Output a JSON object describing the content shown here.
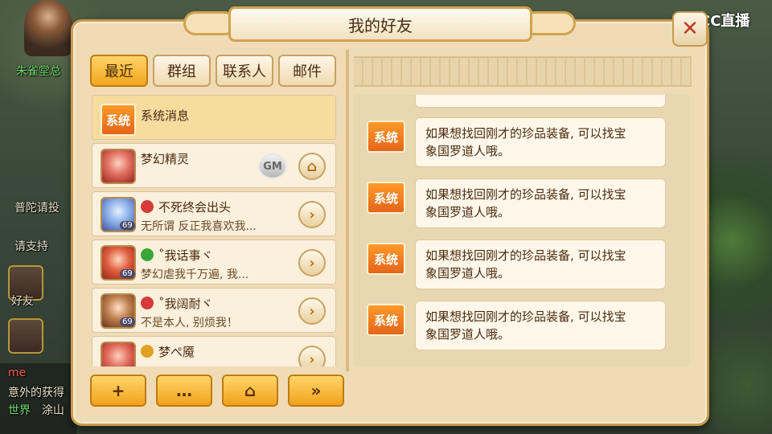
{
  "window": {
    "title": "我的好友",
    "close_icon": "close-x-icon"
  },
  "overlay": {
    "watermark": "CC直播"
  },
  "background_hud": {
    "left_labels": [
      {
        "text": "朱雀堂总",
        "color": "green"
      },
      {
        "text": "普陀请投",
        "color": "normal"
      },
      {
        "text": "请支持",
        "color": "normal"
      },
      {
        "text": "好友",
        "color": "normal"
      },
      {
        "text": "me",
        "color": "normal"
      },
      {
        "text": "意外的获得",
        "color": "normal"
      },
      {
        "text": "世界",
        "color": "green"
      },
      {
        "text": "涂山",
        "color": "normal"
      }
    ]
  },
  "tabs": [
    {
      "label": "最近",
      "active": true
    },
    {
      "label": "群组",
      "active": false
    },
    {
      "label": "联系人",
      "active": false
    },
    {
      "label": "邮件",
      "active": false
    }
  ],
  "friends": [
    {
      "type": "system",
      "name": "系统消息",
      "icon_label": "系统"
    },
    {
      "type": "gm",
      "name": "梦幻精灵",
      "badge": "GM",
      "action_icon": "home-icon"
    },
    {
      "type": "player",
      "name": "不死终会出头",
      "message": "无所谓 反正我喜欢我...",
      "level": "69",
      "status_color": "#d63a3a",
      "action_icon": "chevron-right-icon"
    },
    {
      "type": "player",
      "name": "˚我话事ヾ",
      "message": "梦幻虐我千万遍, 我...",
      "level": "69",
      "status_color": "#3aa63a",
      "action_icon": "chevron-right-icon"
    },
    {
      "type": "player",
      "name": "˚我阔耐ヾ",
      "message": "不是本人, 别烦我！",
      "level": "69",
      "status_color": "#d63a3a",
      "action_icon": "chevron-right-icon"
    },
    {
      "type": "player",
      "name": "梦ぺ魇",
      "message": "",
      "level": "",
      "status_color": "#e0a020",
      "action_icon": "chevron-right-icon"
    }
  ],
  "bottom_buttons": [
    {
      "name": "add-friend-button",
      "icon": "add-user-icon",
      "glyph": "+"
    },
    {
      "name": "chat-button",
      "icon": "chat-bubble-icon",
      "glyph": "…"
    },
    {
      "name": "home-button",
      "icon": "home-icon",
      "glyph": "⌂"
    },
    {
      "name": "more-button",
      "icon": "double-chevron-right-icon",
      "glyph": "»"
    }
  ],
  "messages": [
    {
      "sender_label": "系统",
      "line1": "如果想找回刚才的珍品装备, 可以找宝",
      "line2": "象国罗道人哦。"
    },
    {
      "sender_label": "系统",
      "line1": "如果想找回刚才的珍品装备, 可以找宝",
      "line2": "象国罗道人哦。"
    },
    {
      "sender_label": "系统",
      "line1": "如果想找回刚才的珍品装备, 可以找宝",
      "line2": "象国罗道人哦。"
    },
    {
      "sender_label": "系统",
      "line1": "如果想找回刚才的珍品装备, 可以找宝",
      "line2": "象国罗道人哦。"
    }
  ],
  "colors": {
    "accent": "#f1a71e",
    "panel": "#efdcb7",
    "border": "#c99a52",
    "system_orange": "#e5651a"
  }
}
